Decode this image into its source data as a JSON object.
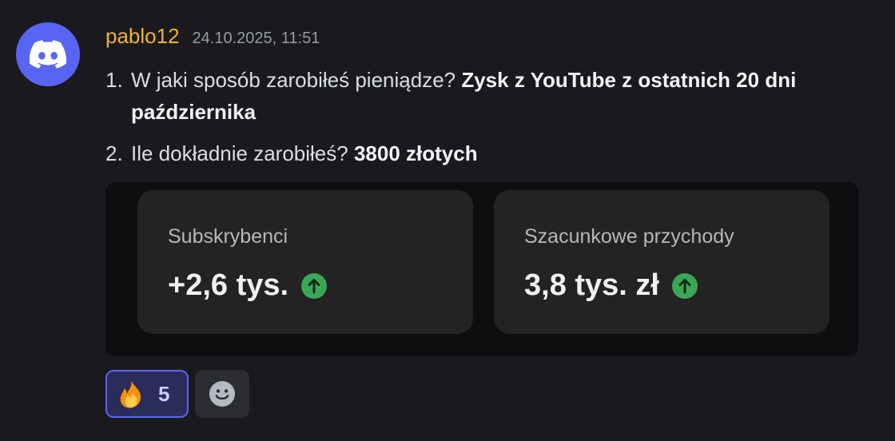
{
  "author": {
    "username": "pablo12",
    "timestamp": "24.10.2025, 11:51",
    "avatar_icon": "discord-logo-icon",
    "username_color": "#f0b232"
  },
  "message": {
    "items": [
      {
        "number": "1.",
        "text": "W jaki sposób zarobiłeś pieniądze? ",
        "bold": "Zysk z YouTube z ostatnich 20 dni października"
      },
      {
        "number": "2.",
        "text": "Ile dokładnie zarobiłeś? ",
        "bold": "3800 złotych"
      }
    ]
  },
  "embed": {
    "cards": [
      {
        "label": "Subskrybenci",
        "value": "+2,6 tys.",
        "trend_icon": "arrow-up-icon"
      },
      {
        "label": "Szacunkowe przychody",
        "value": "3,8 tys. zł",
        "trend_icon": "arrow-up-icon"
      }
    ]
  },
  "reactions": [
    {
      "emoji": "🔥",
      "icon": "fire-emoji-icon",
      "count": "5",
      "active": true
    },
    {
      "icon": "add-reaction-smiley-icon"
    }
  ],
  "colors": {
    "brand": "#5865f2",
    "trend_up": "#3aa757",
    "background": "#1a1a1e"
  }
}
